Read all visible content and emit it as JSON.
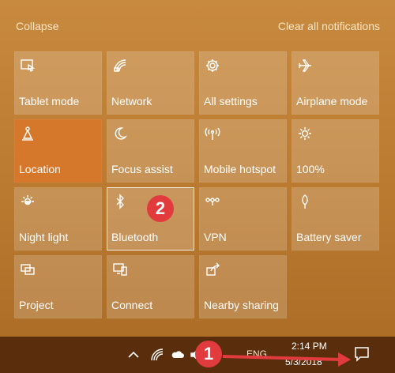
{
  "header": {
    "collapse": "Collapse",
    "clear_all": "Clear all notifications"
  },
  "tiles": [
    {
      "label": "Tablet mode",
      "icon": "tablet-mode-icon"
    },
    {
      "label": "Network",
      "icon": "network-icon"
    },
    {
      "label": "All settings",
      "icon": "gear-icon"
    },
    {
      "label": "Airplane mode",
      "icon": "airplane-icon"
    },
    {
      "label": "Location",
      "icon": "location-icon",
      "active": true
    },
    {
      "label": "Focus assist",
      "icon": "moon-icon"
    },
    {
      "label": "Mobile hotspot",
      "icon": "hotspot-icon"
    },
    {
      "label": "100%",
      "icon": "brightness-icon"
    },
    {
      "label": "Night light",
      "icon": "night-light-icon"
    },
    {
      "label": "Bluetooth",
      "icon": "bluetooth-icon",
      "selected": true
    },
    {
      "label": "VPN",
      "icon": "vpn-icon"
    },
    {
      "label": "Battery saver",
      "icon": "battery-saver-icon"
    },
    {
      "label": "Project",
      "icon": "project-icon"
    },
    {
      "label": "Connect",
      "icon": "connect-icon"
    },
    {
      "label": "Nearby sharing",
      "icon": "nearby-sharing-icon"
    }
  ],
  "taskbar": {
    "language": "ENG",
    "time": "2:14 PM",
    "date": "5/3/2018"
  },
  "annotations": {
    "badge_1": "1",
    "badge_2": "2",
    "color": "#e23b3e"
  },
  "colors": {
    "active_tile": "#d6782c",
    "taskbar": "#5a2e0c"
  }
}
